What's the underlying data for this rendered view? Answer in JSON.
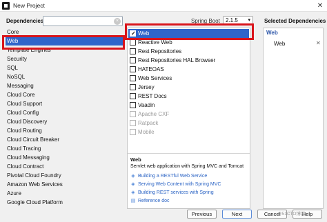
{
  "window": {
    "title": "New Project",
    "close": "✕"
  },
  "dependencies_heading": "Dependencies",
  "search": {
    "value": "",
    "clear": "×"
  },
  "categories": [
    {
      "label": "Core"
    },
    {
      "label": "Web",
      "selected": true
    },
    {
      "label": "Template Engines"
    },
    {
      "label": "Security"
    },
    {
      "label": "SQL"
    },
    {
      "label": "NoSQL"
    },
    {
      "label": "Messaging"
    },
    {
      "label": "Cloud Core"
    },
    {
      "label": "Cloud Support"
    },
    {
      "label": "Cloud Config"
    },
    {
      "label": "Cloud Discovery"
    },
    {
      "label": "Cloud Routing"
    },
    {
      "label": "Cloud Circuit Breaker"
    },
    {
      "label": "Cloud Tracing"
    },
    {
      "label": "Cloud Messaging"
    },
    {
      "label": "Cloud Contract"
    },
    {
      "label": "Pivotal Cloud Foundry"
    },
    {
      "label": "Amazon Web Services"
    },
    {
      "label": "Azure"
    },
    {
      "label": "Google Cloud Platform"
    }
  ],
  "spring_boot": {
    "label": "Spring Boot",
    "version": "2.1.5",
    "chevron": "▾"
  },
  "dependency_items": [
    {
      "label": "Web",
      "checked": true,
      "selected": true
    },
    {
      "label": "Reactive Web"
    },
    {
      "label": "Rest Repositories"
    },
    {
      "label": "Rest Repositories HAL Browser"
    },
    {
      "label": "HATEOAS"
    },
    {
      "label": "Web Services"
    },
    {
      "label": "Jersey"
    },
    {
      "label": "REST Docs"
    },
    {
      "label": "Vaadin"
    },
    {
      "label": "Apache CXF",
      "disabled": true
    },
    {
      "label": "Ratpack",
      "disabled": true
    },
    {
      "label": "Mobile",
      "disabled": true
    }
  ],
  "description": {
    "title": "Web",
    "text": "Servlet web application with Spring MVC and Tomcat",
    "guides": [
      {
        "label": "Building a RESTful Web Service",
        "icon": "guide-icon"
      },
      {
        "label": "Serving Web Content with Spring MVC",
        "icon": "guide-icon"
      },
      {
        "label": "Building REST services with Spring",
        "icon": "guide-icon"
      },
      {
        "label": "Reference doc",
        "icon": "doc-icon"
      }
    ]
  },
  "selected_panel": {
    "heading": "Selected Dependencies",
    "group": "Web",
    "item": "Web",
    "remove": "✕"
  },
  "buttons": {
    "previous": "Previous",
    "next": "Next",
    "cancel": "Cancel",
    "help": "Help"
  },
  "watermark": "@51CTO博客"
}
